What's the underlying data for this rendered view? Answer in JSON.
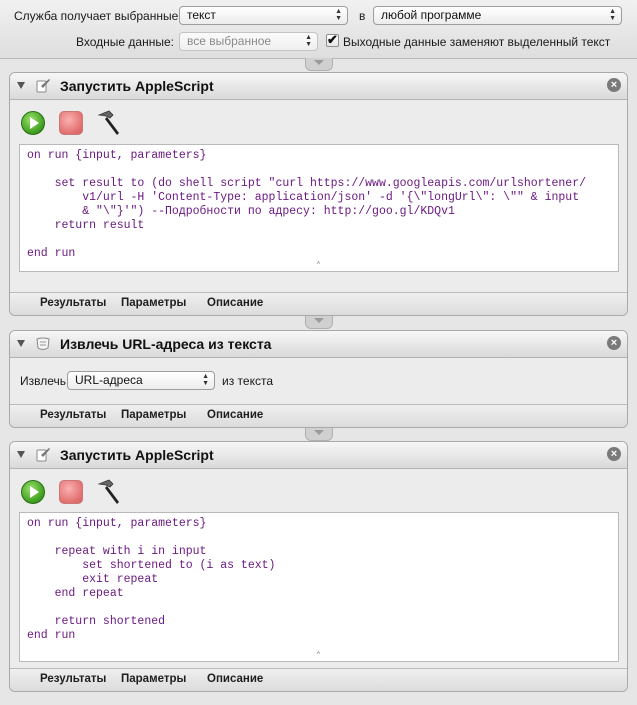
{
  "header": {
    "service_label": "Служба получает выбранные",
    "service_value": "текст",
    "in_label": "в",
    "app_value": "любой программе",
    "input_label": "Входные данные:",
    "input_value": "все выбранное",
    "replace_label": "Выходные данные заменяют выделенный текст",
    "replace_checked": "✔"
  },
  "tabs": {
    "results": "Результаты",
    "options": "Параметры",
    "description": "Описание"
  },
  "action1": {
    "title": "Запустить AppleScript",
    "code": [
      "on run {input, parameters}",
      "",
      "    set result to (do shell script \"curl https://www.googleapis.com/urlshortener/",
      "        v1/url -H 'Content-Type: application/json' -d '{\\\"longUrl\\\": \\\"\" & input",
      "        & \"\\\"}'\") --Подробности по адресу: http://goo.gl/KDQv1",
      "    return result",
      "",
      "end run"
    ]
  },
  "action2": {
    "title": "Извлечь URL-адреса из текста",
    "extract_label": "Извлечь",
    "extract_value": "URL-адреса",
    "from_text_label": "из текста"
  },
  "action3": {
    "title": "Запустить AppleScript",
    "code": [
      "on run {input, parameters}",
      "",
      "    repeat with i in input",
      "        set shortened to (i as text)",
      "        exit repeat",
      "    end repeat",
      "",
      "    return shortened",
      "end run"
    ]
  },
  "icons": {
    "run": "run-icon",
    "stop": "stop-icon",
    "compile": "hammer-icon",
    "close": "close-icon"
  }
}
